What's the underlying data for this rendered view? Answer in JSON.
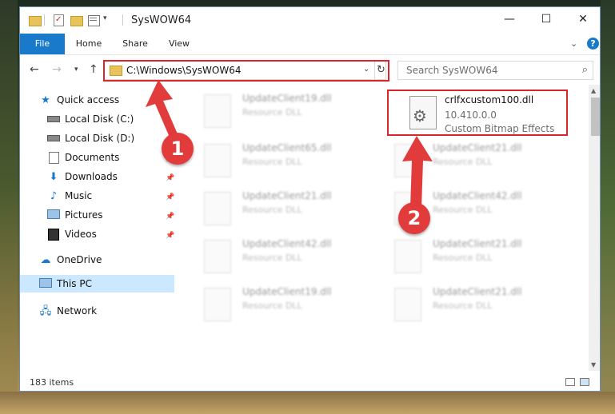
{
  "window": {
    "title": "SysWOW64",
    "controls": {
      "minimize": "—",
      "maximize": "☐",
      "close": "✕"
    }
  },
  "ribbon": {
    "tabs": [
      "File",
      "Home",
      "Share",
      "View"
    ],
    "help": "?"
  },
  "address": {
    "path": "C:\\Windows\\SysWOW64",
    "search_placeholder": "Search SysWOW64"
  },
  "nav_pane": {
    "items": [
      {
        "label": "Quick access",
        "icon": "star-icon"
      },
      {
        "label": "Local Disk (C:)",
        "icon": "drive-icon"
      },
      {
        "label": "Local Disk (D:)",
        "icon": "drive-icon"
      },
      {
        "label": "Documents",
        "icon": "documents-icon"
      },
      {
        "label": "Downloads",
        "icon": "download-icon"
      },
      {
        "label": "Music",
        "icon": "music-icon"
      },
      {
        "label": "Pictures",
        "icon": "pictures-icon"
      },
      {
        "label": "Videos",
        "icon": "videos-icon"
      },
      {
        "label": "OneDrive",
        "icon": "cloud-icon"
      },
      {
        "label": "This PC",
        "icon": "computer-icon"
      },
      {
        "label": "Network",
        "icon": "network-icon"
      }
    ],
    "selected": "This PC"
  },
  "files": {
    "highlighted": {
      "name": "crlfxcustom100.dll",
      "version": "10.410.0.0",
      "description": "Custom Bitmap Effects"
    },
    "blurred": [
      {
        "name": "UpdateClient19.dll",
        "sub": "Resource DLL"
      },
      {
        "name": "UpdateClient65.dll",
        "sub": "Resource DLL"
      },
      {
        "name": "UpdateClient21.dll",
        "sub": "Resource DLL"
      },
      {
        "name": "UpdateClient21.dll",
        "sub": "Resource DLL"
      },
      {
        "name": "UpdateClient42.dll",
        "sub": "Resource DLL"
      },
      {
        "name": "UpdateClient42.dll",
        "sub": "Resource DLL"
      },
      {
        "name": "UpdateClient21.dll",
        "sub": "Resource DLL"
      },
      {
        "name": "UpdateClient19.dll",
        "sub": "Resource DLL"
      },
      {
        "name": "UpdateClient21.dll",
        "sub": "Resource DLL"
      }
    ]
  },
  "status": {
    "item_count": "183 items"
  },
  "annotations": {
    "step1": "1",
    "step2": "2"
  },
  "colors": {
    "accent": "#1979ca",
    "highlight": "#d9262c",
    "badge": "#e23b3b",
    "selection": "#cce8ff"
  }
}
